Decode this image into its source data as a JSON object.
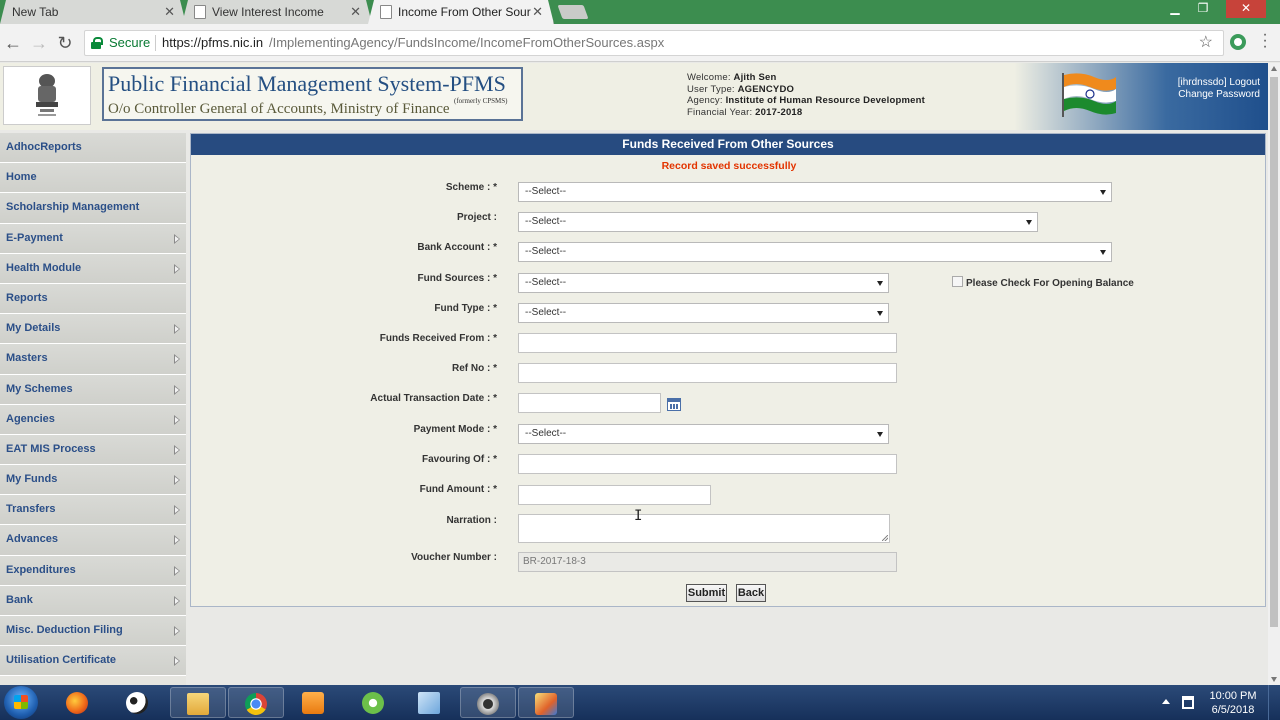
{
  "browser": {
    "tabs": [
      {
        "label": "New Tab",
        "active": false
      },
      {
        "label": "View Interest Income",
        "active": false
      },
      {
        "label": "Income From Other Sour",
        "active": true
      }
    ],
    "secure_label": "Secure",
    "url_host": "https://pfms.nic.in",
    "url_path": "/ImplementingAgency/FundsIncome/IncomeFromOtherSources.aspx"
  },
  "header": {
    "title": "Public Financial Management System-PFMS",
    "formerly": "(formerly CPSMS)",
    "subtitle": "O/o Controller General of Accounts, Ministry of Finance",
    "welcome_label": "Welcome:",
    "welcome_value": "Ajith Sen",
    "user_type_label": "User Type:",
    "user_type_value": "AGENCYDO",
    "agency_label": "Agency:",
    "agency_value": "Institute of Human Resource Development",
    "fy_label": "Financial Year:",
    "fy_value": "2017-2018",
    "user_code": "[ihrdnssdo]",
    "logout": "Logout",
    "change_password": "Change Password"
  },
  "menu": {
    "items": [
      {
        "label": "AdhocReports",
        "arrow": false
      },
      {
        "label": "Home",
        "arrow": false
      },
      {
        "label": "Scholarship Management",
        "arrow": false
      },
      {
        "label": "E-Payment",
        "arrow": true
      },
      {
        "label": "Health Module",
        "arrow": true
      },
      {
        "label": "Reports",
        "arrow": false
      },
      {
        "label": "My Details",
        "arrow": true
      },
      {
        "label": "Masters",
        "arrow": true
      },
      {
        "label": "My Schemes",
        "arrow": true
      },
      {
        "label": "Agencies",
        "arrow": true
      },
      {
        "label": "EAT MIS Process",
        "arrow": true
      },
      {
        "label": "My Funds",
        "arrow": true
      },
      {
        "label": "Transfers",
        "arrow": true
      },
      {
        "label": "Advances",
        "arrow": true
      },
      {
        "label": "Expenditures",
        "arrow": true
      },
      {
        "label": "Bank",
        "arrow": true
      },
      {
        "label": "Misc. Deduction Filing",
        "arrow": true
      },
      {
        "label": "Utilisation Certificate",
        "arrow": true
      }
    ]
  },
  "form": {
    "title": "Funds Received From Other Sources",
    "success_message": "Record saved successfully",
    "scheme_label": "Scheme : *",
    "scheme_value": "--Select--",
    "project_label": "Project :",
    "project_value": "--Select--",
    "bank_account_label": "Bank Account : *",
    "bank_account_value": "--Select--",
    "fund_sources_label": "Fund Sources : *",
    "fund_sources_value": "--Select--",
    "opening_balance_label": "Please Check For Opening Balance",
    "fund_type_label": "Fund Type : *",
    "fund_type_value": "--Select--",
    "funds_received_from_label": "Funds Received From : *",
    "ref_no_label": "Ref No : *",
    "transaction_date_label": "Actual Transaction Date : *",
    "payment_mode_label": "Payment Mode : *",
    "payment_mode_value": "--Select--",
    "favouring_of_label": "Favouring Of : *",
    "fund_amount_label": "Fund Amount : *",
    "narration_label": "Narration :",
    "voucher_number_label": "Voucher Number :",
    "voucher_number_value": "BR-2017-18-3",
    "submit_label": "Submit",
    "back_label": "Back"
  },
  "taskbar": {
    "time": "10:00 PM",
    "date": "6/5/2018"
  },
  "colors": {
    "panel_header": "#274b80",
    "menu_text": "#2b4f88",
    "success": "#e33400",
    "chrome_frame": "#3c8d4f"
  }
}
